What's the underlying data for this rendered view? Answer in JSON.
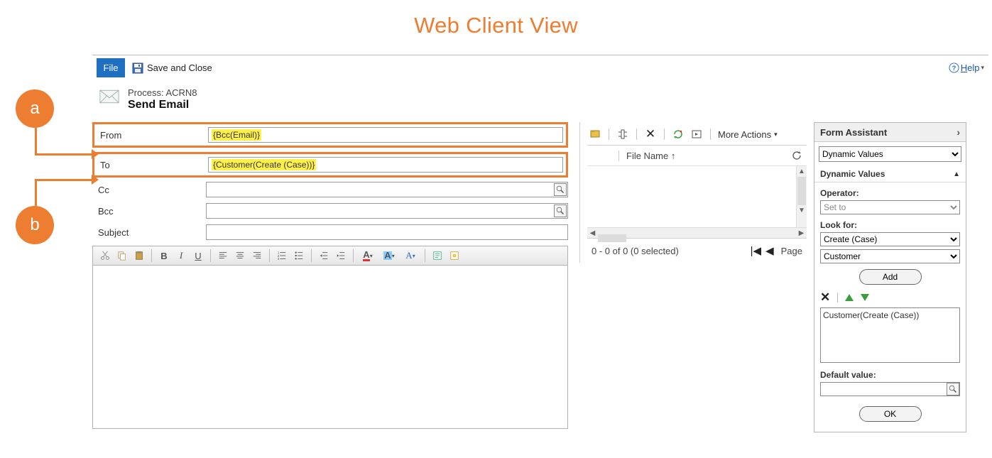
{
  "page_heading": "Web Client View",
  "topbar": {
    "file_label": "File",
    "save_close_label": "Save and Close",
    "help_label": "Help",
    "help_caret": "▾"
  },
  "process": {
    "line1": "Process: ACRN8",
    "line2": "Send Email"
  },
  "fields": {
    "from_label": "From",
    "from_value": "{Bcc(Email)}",
    "to_label": "To",
    "to_value": "{Customer(Create (Case))}",
    "cc_label": "Cc",
    "cc_value": "",
    "bcc_label": "Bcc",
    "bcc_value": "",
    "subject_label": "Subject",
    "subject_value": ""
  },
  "rte_buttons": {
    "cut": "✂",
    "copy": "⧉",
    "paste": "📋",
    "bold": "B",
    "italic": "I",
    "underline": "U",
    "ol": "≡",
    "ul": "•≡",
    "outdent": "⇤",
    "indent": "⇥"
  },
  "attachments": {
    "more_actions": "More Actions",
    "caret": "▾",
    "header_label": "File Name ↑",
    "footer_status": "0 - 0 of 0 (0 selected)",
    "page_label": "Page"
  },
  "assistant": {
    "title": "Form Assistant",
    "dropdown1": "Dynamic Values",
    "subheader": "Dynamic Values",
    "operator_label": "Operator:",
    "operator_value": "Set to",
    "lookfor_label": "Look for:",
    "lookfor_value1": "Create (Case)",
    "lookfor_value2": "Customer",
    "add_label": "Add",
    "list_item": "Customer(Create (Case))",
    "default_label": "Default value:",
    "default_value": "",
    "ok_label": "OK"
  },
  "callouts": {
    "a": "a",
    "b": "b"
  }
}
